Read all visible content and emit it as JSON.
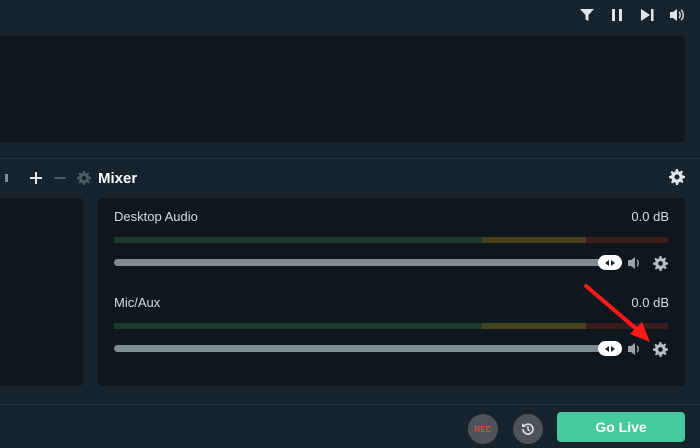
{
  "mixer": {
    "title": "Mixer",
    "sources": [
      {
        "name": "Desktop Audio",
        "level": "0.0 dB",
        "volume": 1.0
      },
      {
        "name": "Mic/Aux",
        "level": "0.0 dB",
        "volume": 1.0
      }
    ]
  },
  "controls": {
    "rec_label": "REC",
    "go_live_label": "Go Live"
  },
  "colors": {
    "accent": "#46c99f",
    "rec_red": "#e74c3c",
    "annotation_arrow": "#ff0000"
  }
}
